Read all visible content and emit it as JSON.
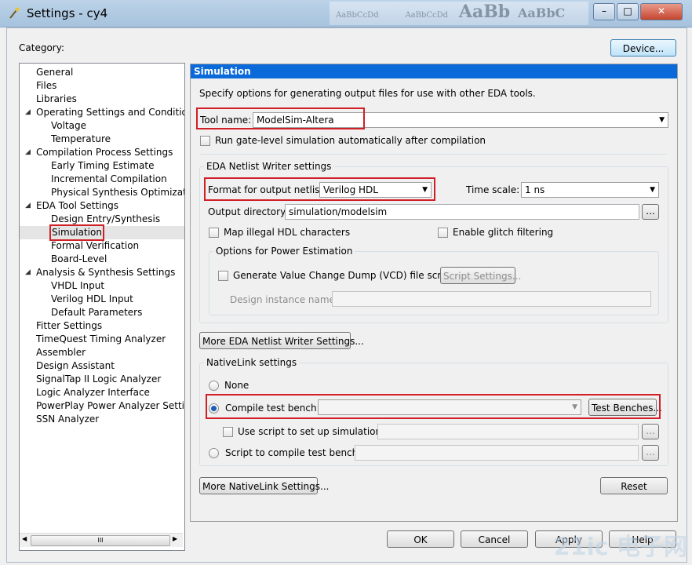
{
  "window": {
    "title": "Settings - cy4",
    "ribbon_ghost": [
      "AaBbCcDd",
      "AaBbCcDd",
      "AaBb",
      "AaBbC"
    ],
    "minimize": "–",
    "maximize": "□",
    "close": "✕"
  },
  "category_label": "Category:",
  "device_button": "Device...",
  "tree": [
    {
      "label": "General",
      "level": 0
    },
    {
      "label": "Files",
      "level": 0
    },
    {
      "label": "Libraries",
      "level": 0
    },
    {
      "label": "Operating Settings and Conditions",
      "level": 0,
      "expanded": true
    },
    {
      "label": "Voltage",
      "level": 1
    },
    {
      "label": "Temperature",
      "level": 1
    },
    {
      "label": "Compilation Process Settings",
      "level": 0,
      "expanded": true
    },
    {
      "label": "Early Timing Estimate",
      "level": 1
    },
    {
      "label": "Incremental Compilation",
      "level": 1
    },
    {
      "label": "Physical Synthesis Optimizations",
      "level": 1
    },
    {
      "label": "EDA Tool Settings",
      "level": 0,
      "expanded": true
    },
    {
      "label": "Design Entry/Synthesis",
      "level": 1
    },
    {
      "label": "Simulation",
      "level": 1,
      "selected": true
    },
    {
      "label": "Formal Verification",
      "level": 1
    },
    {
      "label": "Board-Level",
      "level": 1
    },
    {
      "label": "Analysis & Synthesis Settings",
      "level": 0,
      "expanded": true
    },
    {
      "label": "VHDL Input",
      "level": 1
    },
    {
      "label": "Verilog HDL Input",
      "level": 1
    },
    {
      "label": "Default Parameters",
      "level": 1
    },
    {
      "label": "Fitter Settings",
      "level": 0
    },
    {
      "label": "TimeQuest Timing Analyzer",
      "level": 0
    },
    {
      "label": "Assembler",
      "level": 0
    },
    {
      "label": "Design Assistant",
      "level": 0
    },
    {
      "label": "SignalTap II Logic Analyzer",
      "level": 0
    },
    {
      "label": "Logic Analyzer Interface",
      "level": 0
    },
    {
      "label": "PowerPlay Power Analyzer Settings",
      "level": 0
    },
    {
      "label": "SSN Analyzer",
      "level": 0
    }
  ],
  "tree_scroll_thumb": "III",
  "panel": {
    "header": "Simulation",
    "description": "Specify options for generating output files for use with other EDA tools.",
    "tool_name_label": "Tool name:",
    "tool_name_value": "ModelSim-Altera",
    "run_gate_level": "Run gate-level simulation automatically after compilation",
    "netlist_group": "EDA Netlist Writer settings",
    "format_label": "Format for output netlist:",
    "format_value": "Verilog HDL",
    "time_scale_label": "Time scale:",
    "time_scale_value": "1 ns",
    "output_dir_label": "Output directory:",
    "output_dir_value": "simulation/modelsim",
    "browse": "...",
    "map_illegal": "Map illegal HDL characters",
    "glitch": "Enable glitch filtering",
    "power_group": "Options for Power Estimation",
    "vcd": "Generate Value Change Dump (VCD) file script",
    "script_settings": "Script Settings...",
    "design_instance_label": "Design instance name:",
    "more_netlist": "More EDA Netlist Writer Settings...",
    "nativelink_group": "NativeLink settings",
    "none": "None",
    "compile_tb": "Compile test bench:",
    "test_benches": "Test Benches...",
    "use_script": "Use script to set up simulation:",
    "script_compile": "Script to compile test bench:",
    "more_nativelink": "More NativeLink Settings...",
    "reset": "Reset"
  },
  "footer": {
    "ok": "OK",
    "cancel": "Cancel",
    "apply": "Apply",
    "help": "Help"
  },
  "watermark": "21ic 电子网"
}
